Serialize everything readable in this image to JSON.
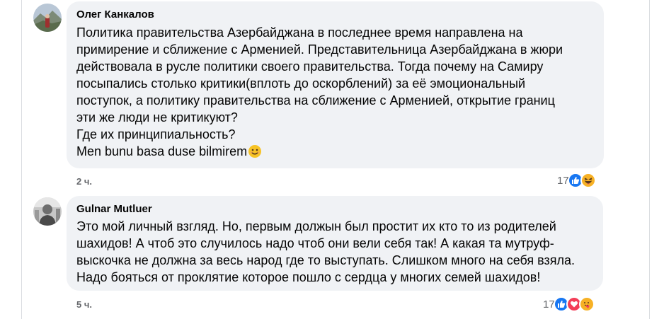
{
  "comments": [
    {
      "author": "Олег Канкалов",
      "lines": [
        "Политика правительства Азербайджана в последнее время направлена на",
        "примирение и сближение с Арменией. Представительница Азербайджана в жюри",
        "действовала в русле политики своего правительства. Тогда почему на Самиру",
        "посыпались столько критики(вплоть до оскорблений) за её эмоциональный",
        "поступок, а политику правительства на сближение с Арменией, открытие границ",
        "эти же люди не критикуют?",
        "Где их принципиальность?",
        "Men bunu basa duse bilmirem"
      ],
      "inline_emoji": "slightly-smiling-face",
      "time": "2 ч.",
      "reaction_count": "17",
      "reaction_icons": [
        "like-icon",
        "haha-icon"
      ]
    },
    {
      "author": "Gulnar Mutluer",
      "lines": [
        "Это мой личный взгляд. Но, первым должын был простит их кто то из родителей",
        "шахидов! А чтоб это случилось надо чтоб они вели себя так! А какая та мутруф-",
        "выскочка не должна за весь народ где то выступать. Слишком много на себя взяла.",
        "Надо бояться от проклятие которое пошло с сердца у многих семей шахидов!"
      ],
      "time": "5 ч.",
      "reaction_count": "17",
      "reaction_icons": [
        "like-icon",
        "love-icon",
        "care-icon"
      ]
    }
  ],
  "colors": {
    "bubble": "#f0f2f5",
    "secondary_text": "#65676b",
    "like": "#1877f2",
    "love": "#f33e58",
    "haha": "#f7b125"
  }
}
